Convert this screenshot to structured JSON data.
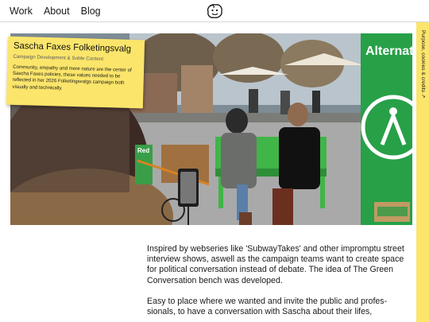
{
  "nav": {
    "items": [
      "Work",
      "About",
      "Blog"
    ],
    "logo_icon": "face-logo-icon"
  },
  "hero": {
    "alt_scene": "street interview photo",
    "banner_text": "Alternat",
    "bench_sign": "Red",
    "colors": {
      "banner_green": "#27a048",
      "bench_green": "#40b548"
    }
  },
  "note": {
    "title": "Sascha Faxes Folketingsvalg",
    "subtitle": "Campaign Development & SoMe Content",
    "body": "Community, empathy and more nature are the center of Sascha Faxes policies, these values needed to be reflected in her 2026 Folketingsvalgs campaign both visually and technically."
  },
  "side_tab": {
    "label": "Purpose, cookies & credits",
    "icon": "expand-arrow-icon",
    "color": "#fbe56b"
  },
  "article": {
    "p1": "Inspired by webseries like 'SubwayTakes' and other impromptu street interview shows, aswell as the campaign teams want to create space for political conversation instead of debate. The idea of The Green Conversation bench was developed.",
    "p2": "Easy to place where we wanted and invite the public and profes-sionals, to have a conversation with Sascha about their lifes,"
  }
}
